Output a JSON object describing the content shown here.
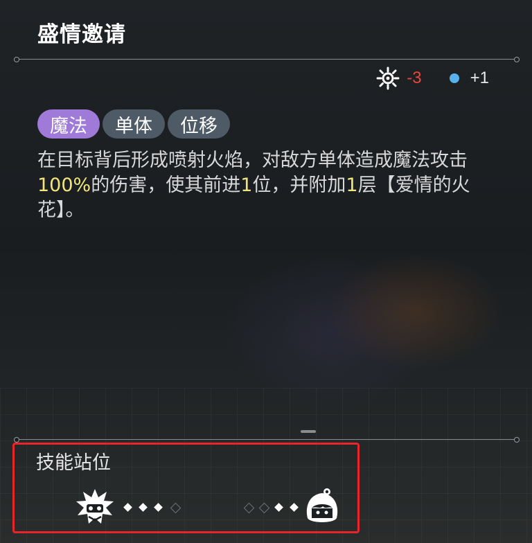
{
  "skill": {
    "title": "盛情邀请",
    "costs": [
      {
        "icon": "sun-icon",
        "value": "-3",
        "color": "#e8483c"
      },
      {
        "icon": "blue-dot-icon",
        "value": "+1",
        "color": "#58b2ec"
      }
    ],
    "tags": [
      "魔法",
      "单体",
      "位移"
    ],
    "description": {
      "part1": "在目标背后形成喷射火焰，对敌方单体造成魔法攻击",
      "highlight": "100%",
      "part2": "的伤害，使其前进",
      "highlight2": "1",
      "part3": "位，并附加",
      "highlight3": "1",
      "part4": "层【爱情的火花】。"
    }
  },
  "position": {
    "label": "技能站位",
    "left_icon": "spiked-mask-character-icon",
    "right_icon": "white-haired-character-icon",
    "left_slots_active": [
      true,
      true,
      true,
      false
    ],
    "right_slots_active": [
      false,
      false,
      true,
      true
    ]
  },
  "colors": {
    "tag_primary": "#a07ad8",
    "tag_secondary": "#4e5b66",
    "highlight_text": "#f2e67a",
    "selection_box": "#e8262a"
  }
}
